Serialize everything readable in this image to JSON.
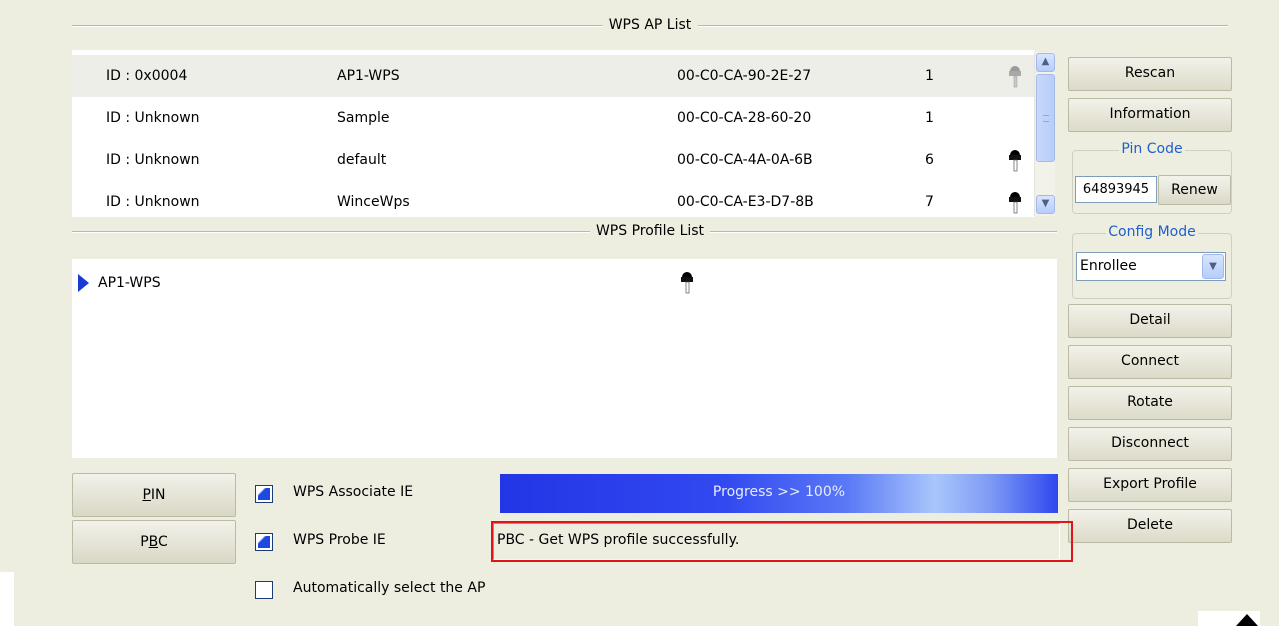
{
  "ap_list": {
    "title": "WPS AP List",
    "rows": [
      {
        "id": "ID : 0x0004",
        "ssid": "AP1-WPS",
        "mac": "00-C0-CA-90-2E-27",
        "channel": "1",
        "encrypted": true,
        "selected": true
      },
      {
        "id": "ID : Unknown",
        "ssid": "Sample",
        "mac": "00-C0-CA-28-60-20",
        "channel": "1",
        "encrypted": false,
        "selected": false
      },
      {
        "id": "ID : Unknown",
        "ssid": "default",
        "mac": "00-C0-CA-4A-0A-6B",
        "channel": "6",
        "encrypted": true,
        "selected": false
      },
      {
        "id": "ID : Unknown",
        "ssid": "WinceWps",
        "mac": "00-C0-CA-E3-D7-8B",
        "channel": "7",
        "encrypted": true,
        "selected": false
      }
    ]
  },
  "profile_list": {
    "title": "WPS Profile List",
    "items": [
      {
        "ssid": "AP1-WPS",
        "encrypted": true
      }
    ]
  },
  "side": {
    "rescan": "Rescan",
    "information": "Information",
    "pin_code_title": "Pin Code",
    "pin_code_value": "64893945",
    "renew": "Renew",
    "config_mode_title": "Config Mode",
    "config_mode_value": "Enrollee",
    "detail": "Detail",
    "connect": "Connect",
    "rotate": "Rotate",
    "disconnect": "Disconnect",
    "export_profile": "Export Profile",
    "delete": "Delete"
  },
  "bottom": {
    "pin_button": {
      "mnemonic": "P",
      "rest": "IN"
    },
    "pbc_button": {
      "start": "P",
      "mnemonic": "B",
      "end": "C"
    },
    "wps_associate_ie": {
      "label": "WPS Associate IE",
      "checked": true
    },
    "wps_probe_ie": {
      "label": "WPS Probe IE",
      "checked": true
    },
    "auto_select_ap": {
      "label": "Automatically select the AP",
      "checked": false
    },
    "progress_text": "Progress >> 100%",
    "progress_percent": 100,
    "status_text": "PBC - Get WPS profile successfully."
  },
  "colors": {
    "panel_bg": "#eeeee0",
    "progress_blue": "#2336e6",
    "status_highlight": "#e0141b",
    "group_title_blue": "#1f5fcb"
  },
  "icons": [
    "key-icon",
    "scroll-up-icon",
    "scroll-down-icon",
    "dropdown-chevron-icon",
    "selection-arrow-icon"
  ]
}
